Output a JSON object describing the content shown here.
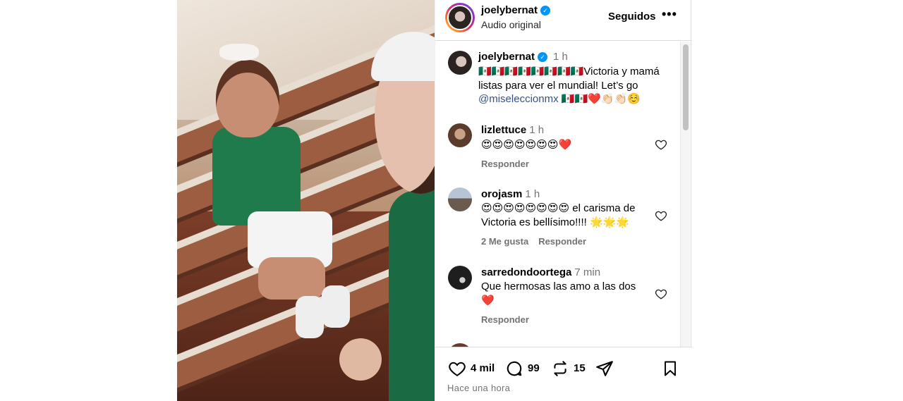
{
  "post": {
    "author": "joelybernat",
    "audio": "Audio original",
    "follow_state": "Seguidos",
    "more_label": "•••",
    "verified_glyph": "✓"
  },
  "caption": {
    "user": "joelybernat",
    "time": "1 h",
    "text_line_1": "🇲🇽🇲🇽🇲🇽🇲🇽🇲🇽🇲🇽🇲🇽🇲🇽Victoria y mamá",
    "text_line_2": "listas para ver el mundial! Let’s go",
    "mention": "@miseleccionmx",
    "text_tail": " 🇲🇽🇲🇽❤️👏🏻👏🏻☺️"
  },
  "comments": [
    {
      "user": "lizlettuce",
      "time": "1 h",
      "text": "😍😍😍😍😍😍😍❤️",
      "likes": "",
      "reply": "Responder"
    },
    {
      "user": "orojasm",
      "time": "1 h",
      "text": "😍😍😍😍😍😍😍😍 el carisma de Victoria es bellísimo!!!! 🌟🌟🌟",
      "likes": "2 Me gusta",
      "reply": "Responder"
    },
    {
      "user": "sarredondoortega",
      "time": "7 min",
      "text": "Que hermosas las amo a las dos ❤️",
      "likes": "",
      "reply": "Responder"
    }
  ],
  "actions": {
    "likes": "4 mil",
    "comments": "99",
    "reposts": "15",
    "timestamp": "Hace una hora"
  },
  "icons": {
    "like": "heart-icon",
    "comment": "comment-icon",
    "repost": "repost-icon",
    "share": "send-icon",
    "save": "bookmark-icon"
  },
  "colors": {
    "verified": "#0095f6",
    "mention": "#385185",
    "muted": "#737373",
    "border": "#dbdbdb"
  }
}
